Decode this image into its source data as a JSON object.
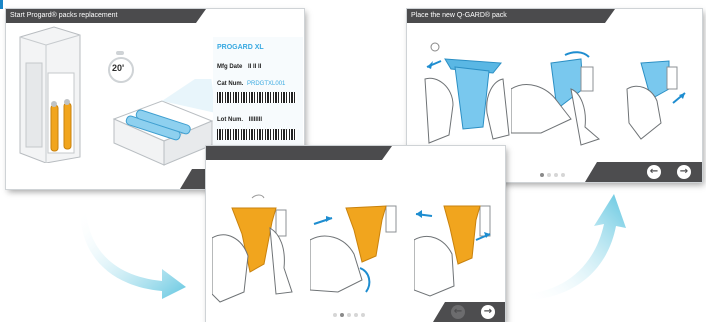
{
  "colors": {
    "blue_accent": "#38a9e1",
    "orange_pack": "#f1a51e",
    "dark_bar": "#4d4d4f",
    "flow_arrow": "#7fd3e6"
  },
  "screen1": {
    "title": "Start Progard® packs replacement",
    "timer": "20'",
    "card": {
      "product": "PROGARD XL",
      "mfg_label": "Mfg Date",
      "mfg_value": "II II II",
      "cat_label": "Cat Num.",
      "cat_value": "PRDGTXL001",
      "lot_label": "Lot Num.",
      "lot_value": "IIIIIIII"
    },
    "buttons": {
      "cancel_icon": "close-icon",
      "confirm_icon": "check-icon"
    }
  },
  "screen2": {
    "title": "Place the new Q-GARD® pack",
    "pager": {
      "count": 4,
      "active": 1
    },
    "buttons": {
      "prev_icon": "arrow-left-icon",
      "next_icon": "arrow-right-icon"
    }
  },
  "screen3": {
    "pager": {
      "count": 5,
      "active": 1
    },
    "buttons": {
      "prev_icon": "arrow-left-icon",
      "next_icon": "arrow-right-icon",
      "prev_disabled": true
    }
  }
}
